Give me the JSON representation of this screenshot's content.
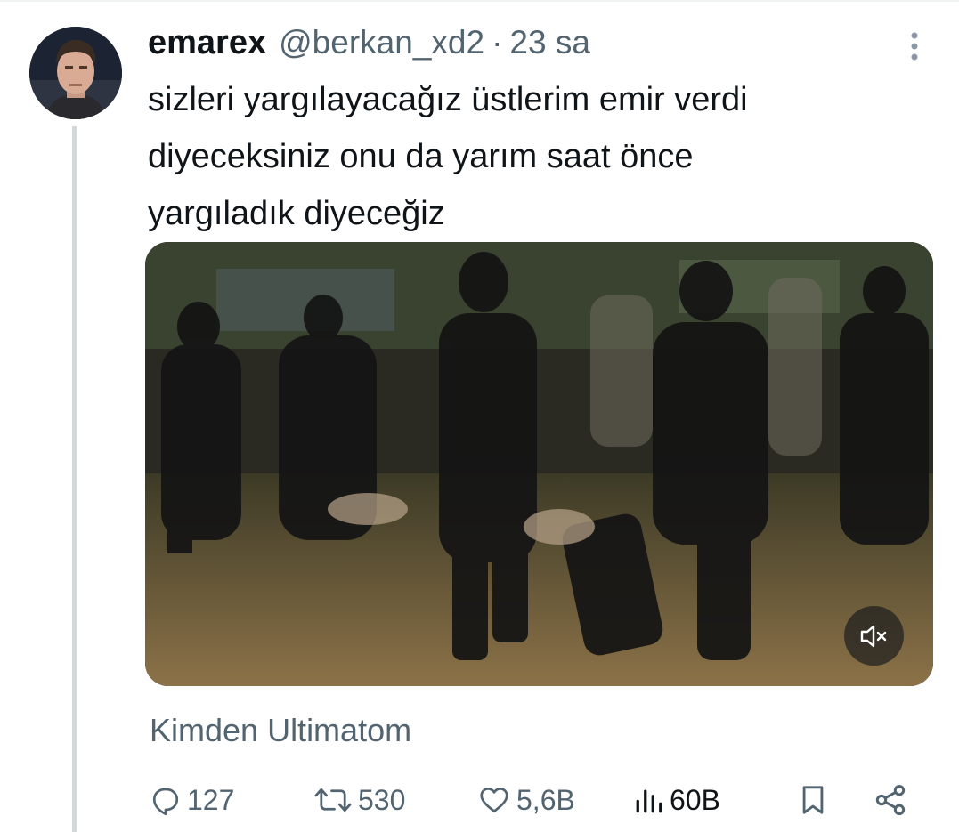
{
  "tweet": {
    "author_name": "emarex",
    "author_handle": "@berkan_xd2",
    "separator": "·",
    "time": "23 sa",
    "text_lines": [
      "sizleri yargılayacağız üstlerim emir verdi",
      "diyeceksiniz onu da yarım saat önce",
      "yargıladık diyeceğiz"
    ],
    "source": "Kimden Ultimatom"
  },
  "media": {
    "type": "video",
    "muted": true,
    "mute_icon": "speaker-muted-icon"
  },
  "actions": {
    "replies": "127",
    "reposts": "530",
    "likes": "5,6B",
    "views": "60B"
  },
  "icons": {
    "more": "more-vertical-icon",
    "reply": "reply-icon",
    "repost": "repost-icon",
    "like": "heart-icon",
    "views": "views-icon",
    "bookmark": "bookmark-icon",
    "share": "share-icon"
  },
  "colors": {
    "text_primary": "#0f1419",
    "text_secondary": "#536471",
    "thread_line": "#cfd9de",
    "views_count": "#0f1419"
  }
}
